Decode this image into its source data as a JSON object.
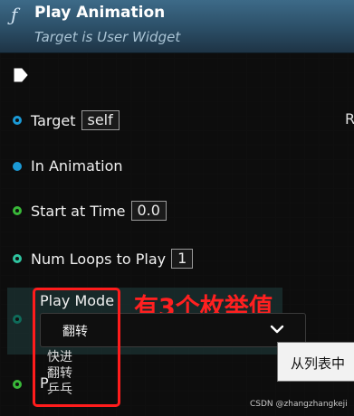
{
  "node": {
    "title": "Play Animation",
    "subtitle": "Target is User Widget",
    "icon": "function-icon"
  },
  "pins": {
    "target": {
      "label": "Target",
      "value": "self"
    },
    "in_animation": {
      "label": "In Animation"
    },
    "start_at_time": {
      "label": "Start at Time",
      "value": "0.0"
    },
    "num_loops": {
      "label": "Num Loops to Play",
      "value": "1"
    },
    "play_mode": {
      "label": "Play Mode",
      "selected": "翻转"
    },
    "bottom": {
      "label": "P"
    }
  },
  "dropdown_options": [
    "快进",
    "翻转",
    "乒乓"
  ],
  "annotation": "有3个枚举值",
  "tooltip": "从列表中",
  "right_edge_text": "R",
  "watermark": "CSDN @zhangzhangkeji",
  "colors": {
    "header": "#2b4e66",
    "object_pin": "#1b9ad6",
    "float_pin": "#39b839",
    "int_pin": "#2fc4a0",
    "byte_pin": "#0f6b5a",
    "annotation_red": "#ff2020"
  }
}
